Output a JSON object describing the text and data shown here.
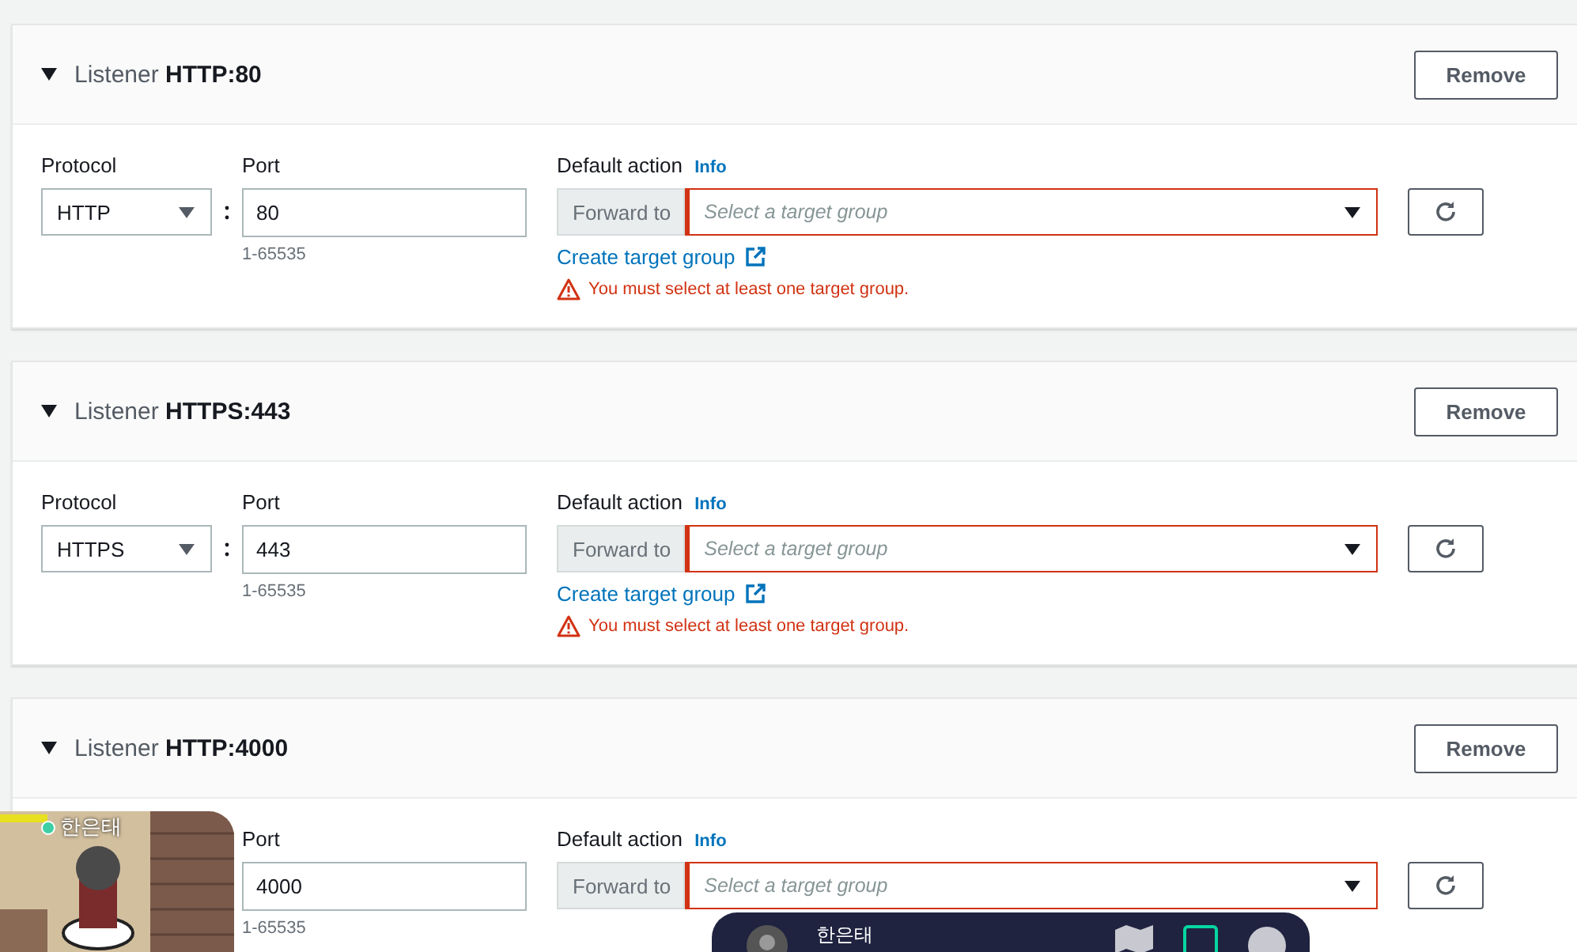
{
  "listeners": [
    {
      "prefix": "Listener",
      "title": "HTTP:80",
      "expanded": true,
      "remove": "Remove",
      "protocol_label": "Protocol",
      "protocol": "HTTP",
      "port_label": "Port",
      "port": "80",
      "port_hint": "1-65535",
      "action_label": "Default action",
      "info": "Info",
      "action_prefix": "Forward to",
      "target_placeholder": "Select a target group",
      "create_link": "Create target group",
      "error": "You must select at least one target group."
    },
    {
      "prefix": "Listener",
      "title": "HTTPS:443",
      "expanded": true,
      "remove": "Remove",
      "protocol_label": "Protocol",
      "protocol": "HTTPS",
      "port_label": "Port",
      "port": "443",
      "port_hint": "1-65535",
      "action_label": "Default action",
      "info": "Info",
      "action_prefix": "Forward to",
      "target_placeholder": "Select a target group",
      "create_link": "Create target group",
      "error": "You must select at least one target group."
    },
    {
      "prefix": "Listener",
      "title": "HTTP:4000",
      "expanded": true,
      "remove": "Remove",
      "port_label": "Port",
      "port": "4000",
      "port_hint": "1-65535",
      "action_label": "Default action",
      "info": "Info",
      "action_prefix": "Forward to",
      "target_placeholder": "Select a target group"
    }
  ],
  "video_tile": {
    "kind": "picture",
    "name": "한은태"
  },
  "call_bar": {
    "user_name": "한은태"
  }
}
